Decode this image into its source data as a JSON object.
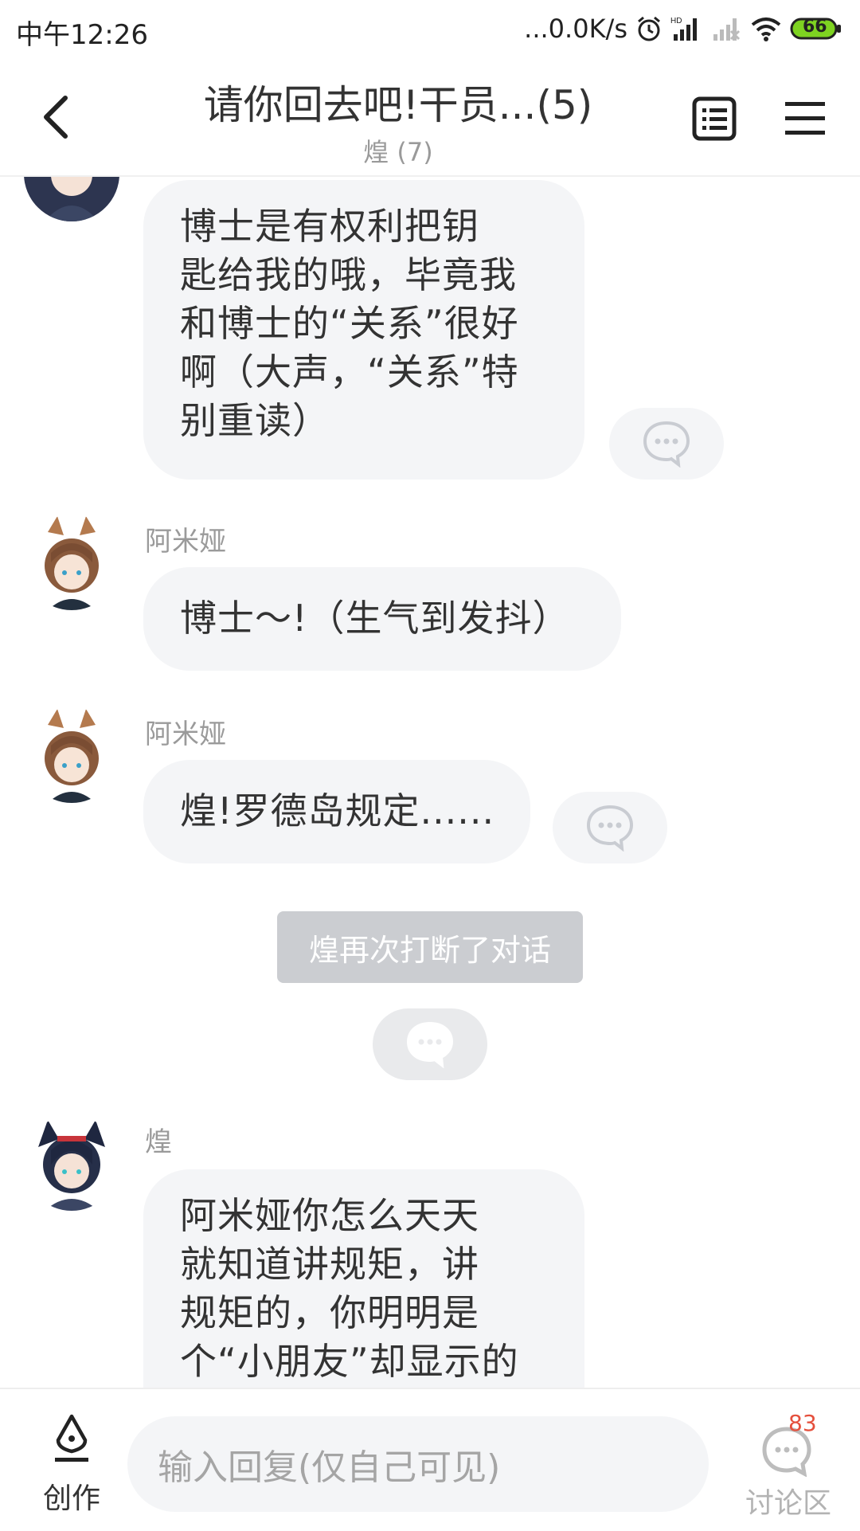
{
  "status_bar": {
    "time": "中午12:26",
    "net_speed": "...0.0K/s",
    "battery": "66",
    "icons": [
      "alarm-icon",
      "signal-hd-icon",
      "signal-icon",
      "wifi-icon",
      "battery-icon"
    ]
  },
  "header": {
    "title": "请你回去吧!干员...(5)",
    "subtitle": "煌 (7)",
    "icons": [
      "back-icon",
      "list-icon",
      "menu-icon"
    ]
  },
  "messages": [
    {
      "speaker": "",
      "avatar": "huang",
      "text": "博士是有权利把钥\n匙给我的哦，毕竟我\n和博士的“关系”很好\n啊（大声，“关系”特\n别重读）",
      "has_comment": true
    },
    {
      "speaker": "阿米娅",
      "avatar": "amiya",
      "text": "博士～!（生气到发抖）",
      "has_comment": false
    },
    {
      "speaker": "阿米娅",
      "avatar": "amiya",
      "text": "煌!罗德岛规定......",
      "has_comment": true
    },
    {
      "speaker": "煌",
      "avatar": "huang",
      "text": "阿米娅你怎么天天\n就知道讲规矩，讲\n规矩的，你明明是\n个“小朋友”却显示的",
      "has_comment": false
    }
  ],
  "system_notice": "煌再次打断了对话",
  "bottom_bar": {
    "create_label": "创作",
    "reply_placeholder": "输入回复(仅自己可见)",
    "discuss_label": "讨论区",
    "discuss_badge": "83"
  },
  "colors": {
    "bubble_bg": "#f4f5f7",
    "notice_bg": "#cbcdd1",
    "badge": "#e5503d",
    "battery_fill": "#7ed321"
  }
}
